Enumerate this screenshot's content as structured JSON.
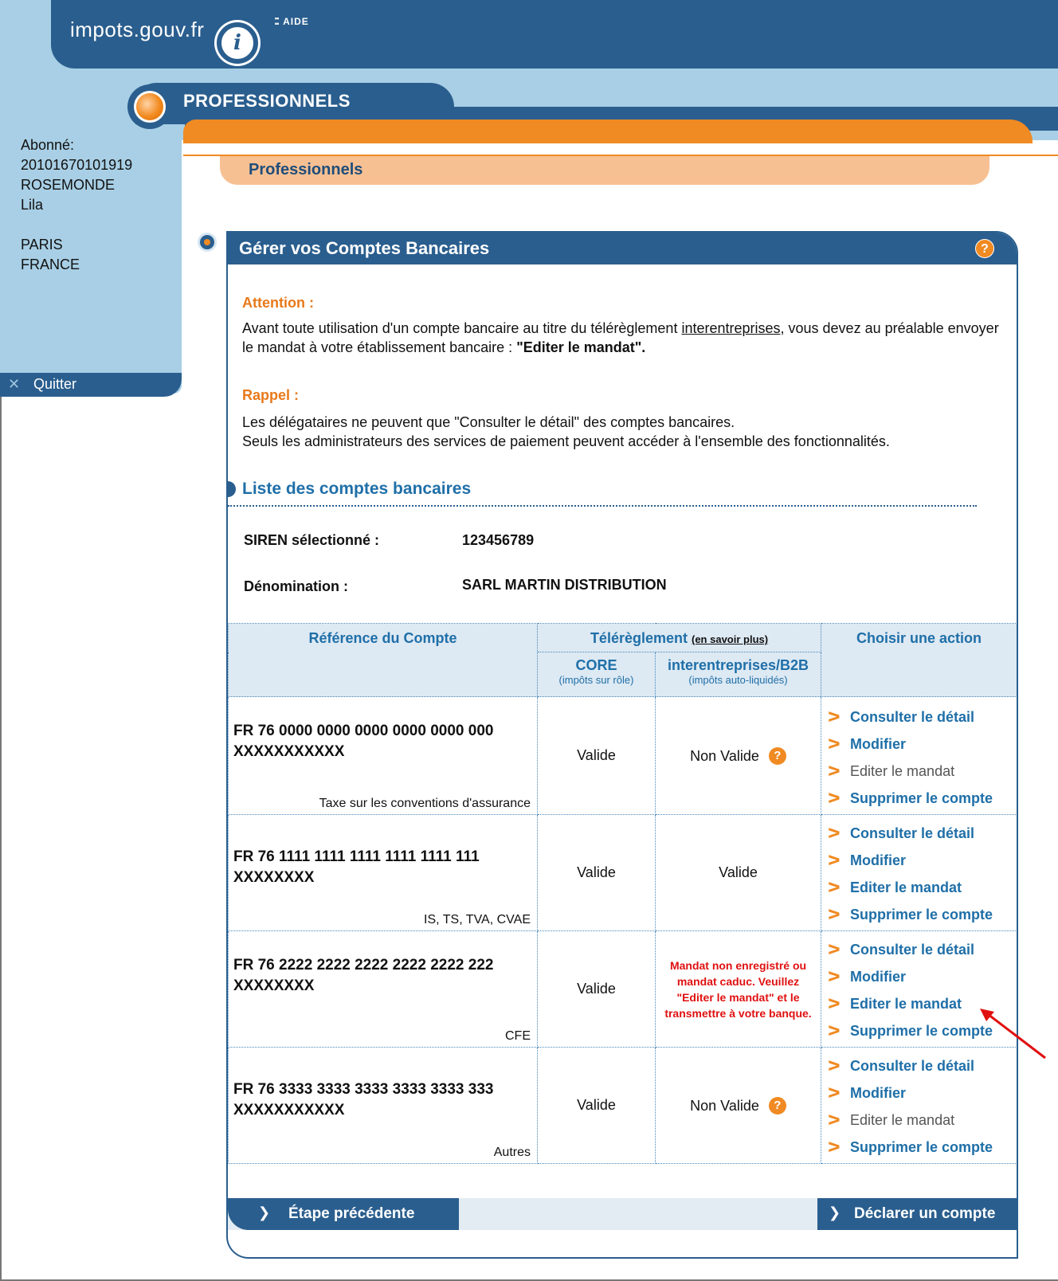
{
  "header": {
    "site_name": "impots.gouv.fr",
    "help_label": "AIDE",
    "section_label": "PROFESSIONNELS",
    "subtab_label": "Professionnels"
  },
  "sidebar": {
    "lines": [
      "Abonné:",
      "20101670101919",
      "ROSEMONDE",
      "Lila",
      "",
      "PARIS",
      "FRANCE"
    ],
    "quit_label": "Quitter"
  },
  "panel": {
    "title": "Gérer vos Comptes Bancaires",
    "attention_title": "Attention :",
    "attention_text_1": "Avant toute utilisation d'un compte bancaire au titre du télérèglement ",
    "attention_link": "interentreprises",
    "attention_text_2": ", vous devez au préalable envoyer le mandat à votre établissement bancaire : ",
    "attention_bold": "\"Editer le mandat\".",
    "rappel_title": "Rappel :",
    "rappel_line1": "Les délégataires ne peuvent que \"Consulter le détail\" des comptes bancaires.",
    "rappel_line2": "Seuls les administrateurs des services de paiement peuvent accéder à l'ensemble des fonctionnalités.",
    "list_title": "Liste des comptes bancaires",
    "siren_label": "SIREN sélectionné :",
    "siren_value": "123456789",
    "denomination_label": "Dénomination :",
    "denomination_value": "SARL MARTIN DISTRIBUTION"
  },
  "table": {
    "col_ref": "Référence du Compte",
    "col_telereglement": "Télérèglement",
    "col_more_link": "(en savoir plus)",
    "col_action": "Choisir une action",
    "sub_core": "CORE",
    "sub_core_note": "(impôts sur rôle)",
    "sub_b2b": "interentreprises/B2B",
    "sub_b2b_note": "(impôts auto-liquidés)",
    "rows": [
      {
        "iban_line1": "FR 76 0000 0000 0000 0000 0000 000",
        "iban_line2": "XXXXXXXXXXX",
        "tax": "Taxe sur les conventions d'assurance",
        "core": "Valide",
        "b2b": "Non Valide",
        "actions": [
          "Consulter le détail",
          "Modifier",
          "Editer le mandat",
          "Supprimer le compte"
        ]
      },
      {
        "iban_line1": "FR 76 1111 1111 1111 1111 1111 111",
        "iban_line2": "XXXXXXXX",
        "tax": "IS, TS, TVA, CVAE",
        "core": "Valide",
        "b2b": "Valide",
        "actions": [
          "Consulter le détail",
          "Modifier",
          "Editer le mandat",
          "Supprimer le compte"
        ]
      },
      {
        "iban_line1": "FR 76 2222 2222 2222 2222 2222 222",
        "iban_line2": "XXXXXXXX",
        "tax": "CFE",
        "core": "Valide",
        "b2b": "Mandat non enregistré ou mandat caduc. Veuillez \"Editer le mandat\" et le transmettre à votre banque.",
        "actions": [
          "Consulter le détail",
          "Modifier",
          "Editer le mandat",
          "Supprimer le compte"
        ]
      },
      {
        "iban_line1": "FR 76 3333 3333 3333 3333 3333 333",
        "iban_line2": "XXXXXXXXXXX",
        "tax": "Autres",
        "core": "Valide",
        "b2b": "Non Valide",
        "actions": [
          "Consulter le détail",
          "Modifier",
          "Editer le mandat",
          "Supprimer le compte"
        ]
      }
    ]
  },
  "footer": {
    "prev_label": "Étape précédente",
    "next_label": "Déclarer un compte"
  },
  "colors": {
    "brand_blue": "#2a5e8e",
    "light_blue": "#a8cfe5",
    "orange": "#f08a22",
    "link_blue": "#1f6fa8",
    "error_red": "#e01010"
  },
  "icons": [
    "impots-logo-icon",
    "aide-dots-icon",
    "professionnels-orb-icon",
    "quit-icon",
    "section-bullet-icon",
    "help-icon",
    "chevron-right-icon",
    "annotation-arrow-icon"
  ]
}
